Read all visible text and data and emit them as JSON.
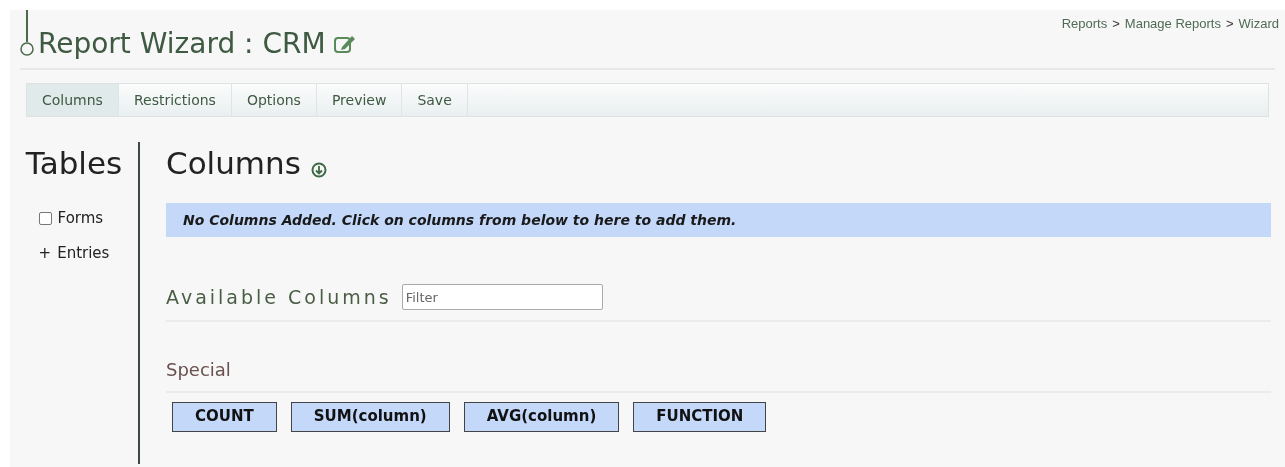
{
  "header": {
    "title": "Report Wizard : CRM"
  },
  "breadcrumb": [
    {
      "kind": "link",
      "text": "Reports"
    },
    {
      "kind": "separator",
      "text": ">"
    },
    {
      "kind": "link",
      "text": "Manage Reports"
    },
    {
      "kind": "separator",
      "text": ">"
    },
    {
      "kind": "link",
      "text": "Wizard"
    }
  ],
  "tabs": [
    {
      "label": "Columns",
      "selected": true
    },
    {
      "label": "Restrictions",
      "selected": false
    },
    {
      "label": "Options",
      "selected": false
    },
    {
      "label": "Preview",
      "selected": false
    },
    {
      "label": "Save",
      "selected": false
    }
  ],
  "sidebar": {
    "title": "Tables",
    "items": [
      {
        "kind": "checkbox",
        "label": "Forms",
        "checked": false
      },
      {
        "kind": "expander",
        "symbol": "+",
        "label": "Entries"
      }
    ]
  },
  "main": {
    "title": "Columns",
    "notice": "No Columns Added. Click on columns from below to here to add them.",
    "available": {
      "title": "Available Columns",
      "filter": {
        "placeholder": "Filter"
      }
    },
    "special": {
      "title": "Special",
      "buttons": [
        "COUNT",
        "SUM(column)",
        "AVG(column)",
        "FUNCTION"
      ]
    }
  }
}
